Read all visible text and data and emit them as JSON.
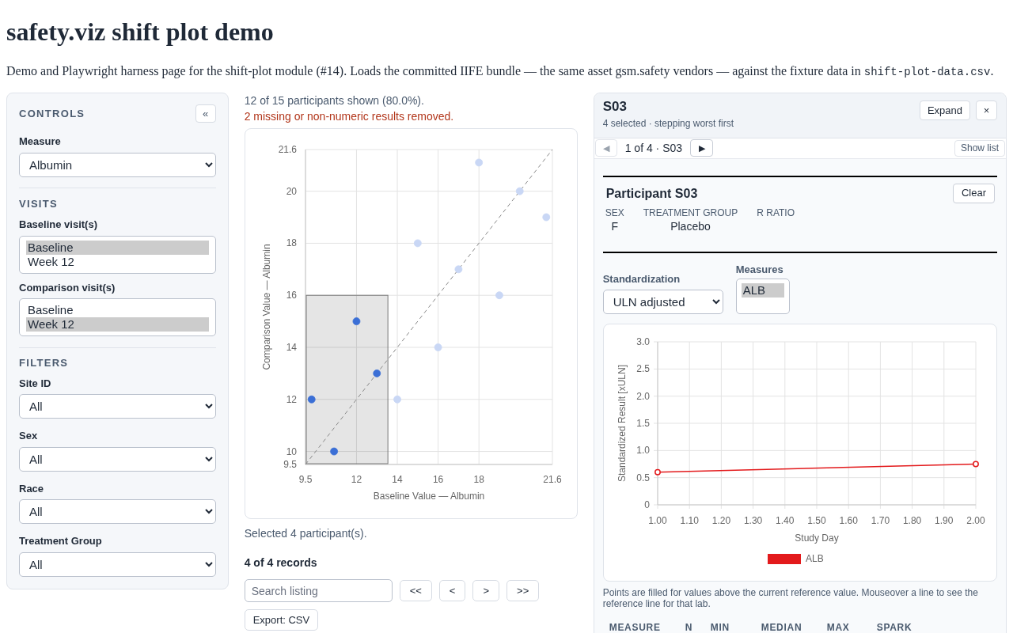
{
  "page": {
    "title": "safety.viz shift plot demo",
    "intro_before_code": "Demo and Playwright harness page for the shift-plot module (#14). Loads the committed IIFE bundle — the same asset gsm.safety vendors — against the fixture data in",
    "intro_code": "shift-plot-data.csv",
    "intro_after_code": "."
  },
  "controls": {
    "title": "CONTROLS",
    "collapse_button": "«",
    "measure": {
      "label": "Measure",
      "value": "Albumin"
    },
    "visits": {
      "title": "VISITS",
      "lists": [
        {
          "label": "Baseline visit(s)",
          "options": [
            {
              "label": "Baseline",
              "selected": true
            },
            {
              "label": "Week 12",
              "selected": false
            }
          ]
        },
        {
          "label": "Comparison visit(s)",
          "options": [
            {
              "label": "Baseline",
              "selected": false
            },
            {
              "label": "Week 12",
              "selected": true
            }
          ]
        }
      ]
    },
    "filters": {
      "title": "FILTERS",
      "items": [
        {
          "label": "Site ID",
          "value": "All"
        },
        {
          "label": "Sex",
          "value": "All"
        },
        {
          "label": "Race",
          "value": "All"
        },
        {
          "label": "Treatment Group",
          "value": "All"
        }
      ]
    }
  },
  "shift_plot": {
    "summary": "12 of 15 participants shown (80.0%).",
    "warning": "2 missing or non-numeric results removed.",
    "chart_data": {
      "type": "scatter",
      "xlabel": "Baseline Value — Albumin",
      "ylabel": "Comparison Value — Albumin",
      "xlim": [
        9.5,
        21.6
      ],
      "ylim": [
        9.5,
        21.6
      ],
      "xticks": [
        9.5,
        12,
        14,
        16,
        18,
        21.6
      ],
      "yticks": [
        9.5,
        10,
        12,
        14,
        16,
        18,
        20,
        21.6
      ],
      "grid": true,
      "series": [
        {
          "color": "#3b6fd6",
          "x": [
            9.8,
            10.9,
            12,
            13
          ],
          "values": [
            12,
            10,
            15,
            13
          ]
        },
        {
          "color": "#c9d7f5",
          "x": [
            14,
            15,
            16,
            17,
            18,
            19,
            20,
            21.3
          ],
          "values": [
            12,
            18,
            14,
            17,
            21.1,
            16,
            20,
            19
          ]
        },
        {
          "type": "line",
          "line_style": "dashed",
          "color": "#888888",
          "x": [
            9.5,
            21.6
          ],
          "values": [
            9.5,
            21.6
          ]
        }
      ]
    },
    "selection_note": "Selected 4 participant(s).",
    "listing": {
      "count": "4 of 4 records",
      "search_placeholder": "Search listing",
      "pager": [
        "<<",
        "<",
        ">",
        ">>"
      ],
      "export": "Export: CSV"
    }
  },
  "detail": {
    "title": "S03",
    "subtitle": "4 selected · stepping worst first",
    "expand": "Expand",
    "close": "×",
    "nav": {
      "prev": "◀",
      "prev_disabled": true,
      "position": "1 of 4 · S03",
      "next": "▶",
      "next_disabled": false,
      "show_list": "Show list"
    },
    "participant": {
      "title": "Participant S03",
      "clear": "Clear",
      "fields": [
        {
          "label": "SEX",
          "value": "F"
        },
        {
          "label": "TREATMENT GROUP",
          "value": "Placebo"
        },
        {
          "label": "R RATIO"
        }
      ]
    },
    "standardization": {
      "label": "Standardization",
      "value": "ULN adjusted"
    },
    "measures": {
      "label": "Measures",
      "options": [
        {
          "label": "ALB",
          "selected": true
        }
      ]
    },
    "chart_data": {
      "type": "line",
      "xlabel": "Study Day",
      "ylabel": "Standardized Result [xULN]",
      "xlim": [
        1,
        2
      ],
      "ylim": [
        0,
        3
      ],
      "xticks": [
        {
          "value": 1,
          "label": "1.00"
        },
        {
          "value": 1.1,
          "label": "1.10"
        },
        {
          "value": 1.2,
          "label": "1.20"
        },
        {
          "value": 1.3,
          "label": "1.30"
        },
        {
          "value": 1.4,
          "label": "1.40"
        },
        {
          "value": 1.5,
          "label": "1.50"
        },
        {
          "value": 1.6,
          "label": "1.60"
        },
        {
          "value": 1.7,
          "label": "1.70"
        },
        {
          "value": 1.8,
          "label": "1.80"
        },
        {
          "value": 1.9,
          "label": "1.90"
        },
        {
          "value": 2,
          "label": "2.00"
        }
      ],
      "yticks": [
        {
          "value": 0,
          "label": "0"
        },
        {
          "value": 0.5,
          "label": "0.5"
        },
        {
          "value": 1,
          "label": "1.0"
        },
        {
          "value": 1.5,
          "label": "1.5"
        },
        {
          "value": 2,
          "label": "2.0"
        },
        {
          "value": 2.5,
          "label": "2.5"
        },
        {
          "value": 3,
          "label": "3.0"
        }
      ],
      "x": [
        1,
        2
      ],
      "grid": true,
      "series": [
        {
          "name": "ALB",
          "color": "#e31a1c",
          "marker": "circle",
          "values": [
            0.6,
            0.75
          ]
        }
      ]
    },
    "note": "Points are filled for values above the current reference value. Mouseover a line to see the reference line for that lab.",
    "table_columns": [
      "MEASURE",
      "N",
      "MIN",
      "MEDIAN",
      "MAX",
      "SPARK"
    ]
  }
}
